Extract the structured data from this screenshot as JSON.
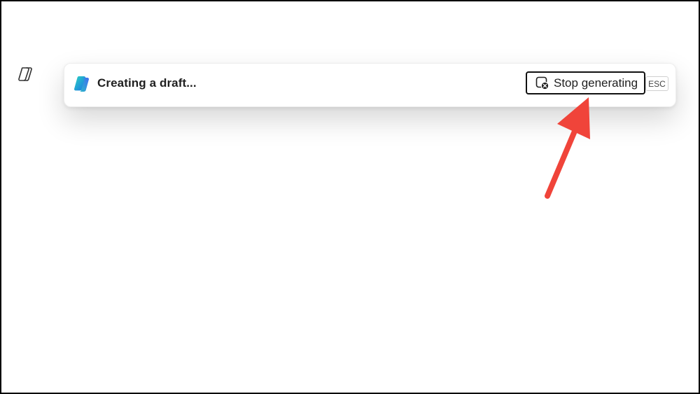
{
  "draft_bar": {
    "status_text": "Creating a draft...",
    "stop_button_label": "Stop generating",
    "shortcut_label": "ESC"
  },
  "icons": {
    "margin": "copilot-outline-icon",
    "bar": "copilot-logo-icon",
    "stop": "stop-circle-icon"
  },
  "colors": {
    "annotation_arrow": "#f0443a",
    "button_border": "#111111",
    "copilot_blue": "#1a73e8",
    "copilot_teal": "#2bb6c9"
  }
}
